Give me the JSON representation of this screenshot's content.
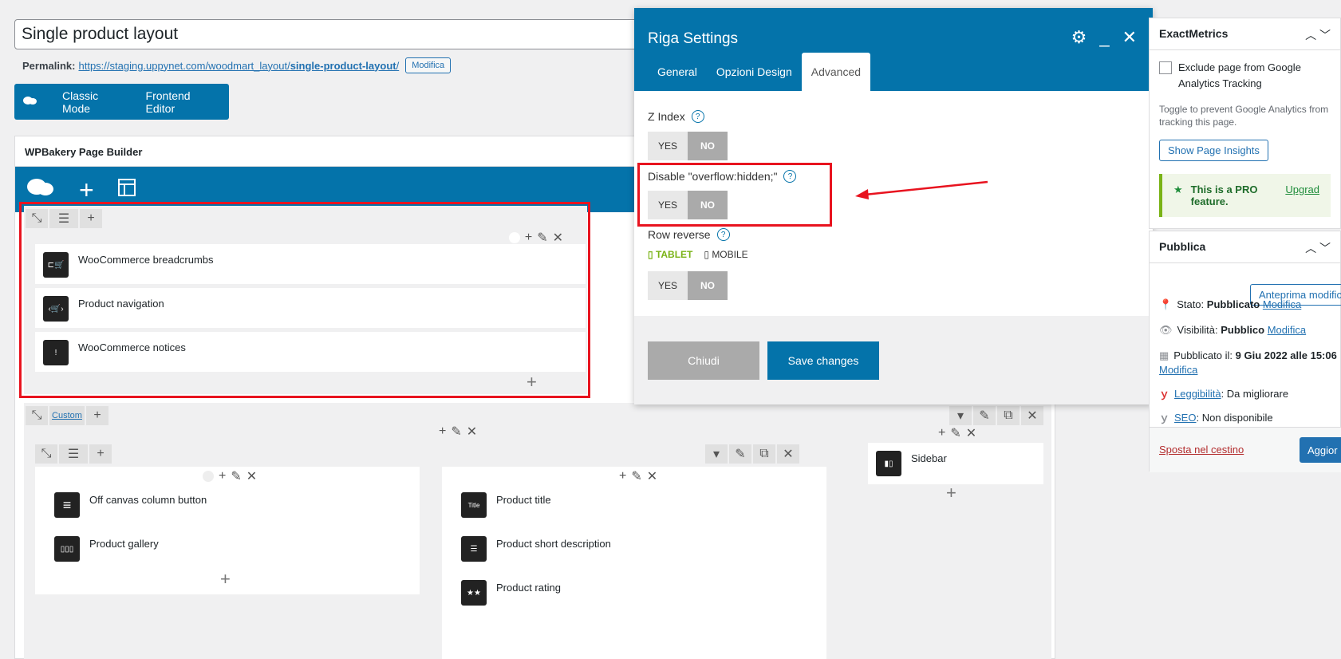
{
  "post": {
    "title_value": "Single product layout",
    "permalink_label": "Permalink:",
    "permalink_url_prefix": "https://staging.uppynet.com/woodmart_layout/",
    "permalink_slug": "single-product-layout",
    "permalink_trailing": "/",
    "permalink_edit": "Modifica"
  },
  "mode_bar": {
    "classic": "Classic Mode",
    "frontend": "Frontend Editor"
  },
  "builder": {
    "title": "WPBakery Page Builder",
    "row1_elements": [
      {
        "label": "WooCommerce breadcrumbs"
      },
      {
        "label": "Product navigation"
      },
      {
        "label": "WooCommerce notices"
      }
    ],
    "row2_custom": "Custom",
    "col_left_elements": [
      {
        "label": "Off canvas column button"
      },
      {
        "label": "Product gallery"
      }
    ],
    "col_mid_elements": [
      {
        "label": "Product title"
      },
      {
        "label": "Product short description"
      },
      {
        "label": "Product rating"
      }
    ],
    "col_mid_icon_text": "Title",
    "col_right_elements": [
      {
        "label": "Sidebar"
      }
    ]
  },
  "modal": {
    "title": "Riga Settings",
    "tabs": [
      "General",
      "Opzioni Design",
      "Advanced"
    ],
    "zindex_label": "Z Index",
    "overflow_label": "Disable \"overflow:hidden;\"",
    "row_reverse_label": "Row reverse",
    "tablet_label": "TABLET",
    "mobile_label": "MOBILE",
    "yes": "YES",
    "no": "NO",
    "help": "?",
    "close_btn": "Chiudi",
    "save_btn": "Save changes"
  },
  "exactmetrics": {
    "title": "ExactMetrics",
    "checkbox_label": "Exclude page from Google Analytics Tracking",
    "help_text": "Toggle to prevent Google Analytics from tracking this page.",
    "insights_btn": "Show Page Insights",
    "pro_text": "This is a PRO feature.",
    "upgrade": "Upgrad"
  },
  "publish": {
    "title": "Pubblica",
    "preview_btn": "Anteprima modific",
    "status_label": "Stato:",
    "status_value": "Pubblicato",
    "visibility_label": "Visibilità:",
    "visibility_value": "Pubblico",
    "published_label": "Pubblicato il:",
    "published_value": "9 Giu 2022 alle 15:06",
    "edit": "Modifica",
    "readability_label": "Leggibilità",
    "readability_value": ": Da migliorare",
    "seo_label": "SEO",
    "seo_value": ": Non disponibile",
    "trash": "Sposta nel cestino",
    "update_btn": "Aggior"
  },
  "colors": {
    "wpbakery_blue": "#0473aa",
    "highlight_red": "#e8131f",
    "wp_link": "#2271b1"
  }
}
